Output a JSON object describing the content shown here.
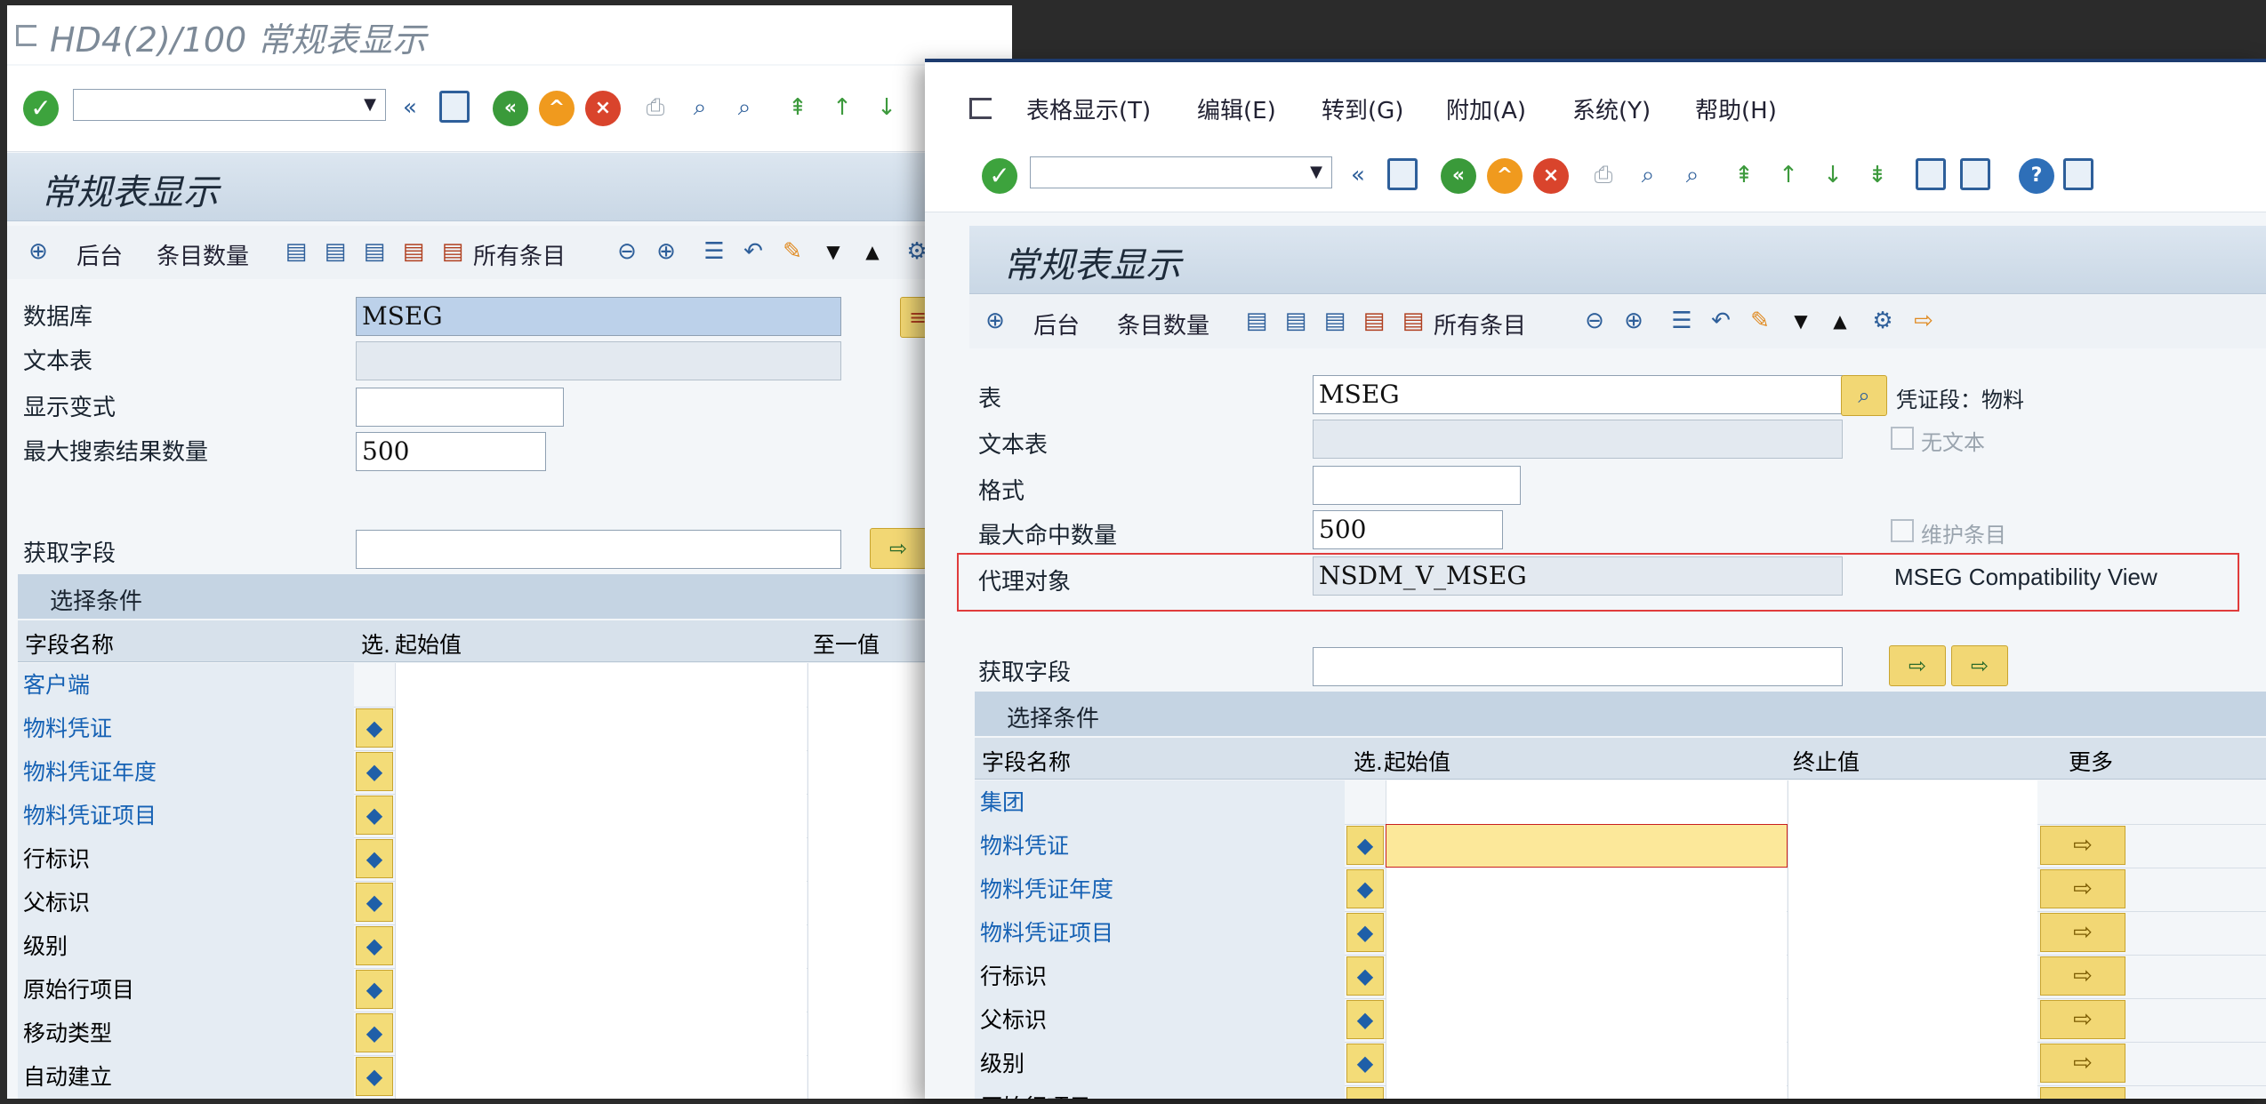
{
  "back_window": {
    "title": "HD4(2)/100 常规表显示",
    "page_title": "常规表显示",
    "app_toolbar": {
      "background_label": "后台",
      "entry_count_label": "条目数量",
      "all_entries_label": "所有条目"
    },
    "fields": {
      "database_label": "数据库",
      "database_value": "MSEG",
      "text_table_label": "文本表",
      "display_variant_label": "显示变式",
      "max_hits_label": "最大搜索结果数量",
      "max_hits_value": "500",
      "get_fields_label": "获取字段"
    },
    "selection": {
      "section_title": "选择条件",
      "headers": {
        "field_name": "字段名称",
        "sel": "选.",
        "from": "起始值",
        "to": "至一值"
      },
      "rows": [
        {
          "name": "客户端",
          "link": true
        },
        {
          "name": "物料凭证",
          "link": true
        },
        {
          "name": "物料凭证年度",
          "link": true
        },
        {
          "name": "物料凭证项目",
          "link": true
        },
        {
          "name": "行标识",
          "link": false
        },
        {
          "name": "父标识",
          "link": false
        },
        {
          "name": "级别",
          "link": false
        },
        {
          "name": "原始行项目",
          "link": false
        },
        {
          "name": "移动类型",
          "link": false
        },
        {
          "name": "自动建立",
          "link": false
        }
      ]
    }
  },
  "front_window": {
    "menu": [
      {
        "label": "表格显示(T)"
      },
      {
        "label": "编辑(E)"
      },
      {
        "label": "转到(G)"
      },
      {
        "label": "附加(A)"
      },
      {
        "label": "系统(Y)"
      },
      {
        "label": "帮助(H)"
      }
    ],
    "page_title": "常规表显示",
    "app_toolbar": {
      "background_label": "后台",
      "entry_count_label": "条目数量",
      "all_entries_label": "所有条目"
    },
    "fields": {
      "table_label": "表",
      "table_value": "MSEG",
      "table_desc": "凭证段：物料",
      "text_table_label": "文本表",
      "no_text_label": "无文本",
      "format_label": "格式",
      "max_hits_label": "最大命中数量",
      "max_hits_value": "500",
      "maintain_entries_label": "维护条目",
      "proxy_label": "代理对象",
      "proxy_value": "NSDM_V_MSEG",
      "proxy_desc": "MSEG Compatibility View",
      "get_fields_label": "获取字段"
    },
    "selection": {
      "section_title": "选择条件",
      "headers": {
        "field_name": "字段名称",
        "sel": "选.",
        "from": "起始值",
        "to": "终止值",
        "more": "更多"
      },
      "rows": [
        {
          "name": "集团",
          "link": true,
          "has_sel": false
        },
        {
          "name": "物料凭证",
          "link": true,
          "has_sel": true,
          "focused": true
        },
        {
          "name": "物料凭证年度",
          "link": true,
          "has_sel": true
        },
        {
          "name": "物料凭证项目",
          "link": true,
          "has_sel": true
        },
        {
          "name": "行标识",
          "link": false,
          "has_sel": true
        },
        {
          "name": "父标识",
          "link": false,
          "has_sel": true
        },
        {
          "name": "级别",
          "link": false,
          "has_sel": true
        },
        {
          "name": "原始行项目",
          "link": false,
          "has_sel": true
        }
      ]
    }
  },
  "colors": {
    "highlight_border": "#e03c3c",
    "link": "#1561b4",
    "title_blue": "#1d3b6e"
  }
}
